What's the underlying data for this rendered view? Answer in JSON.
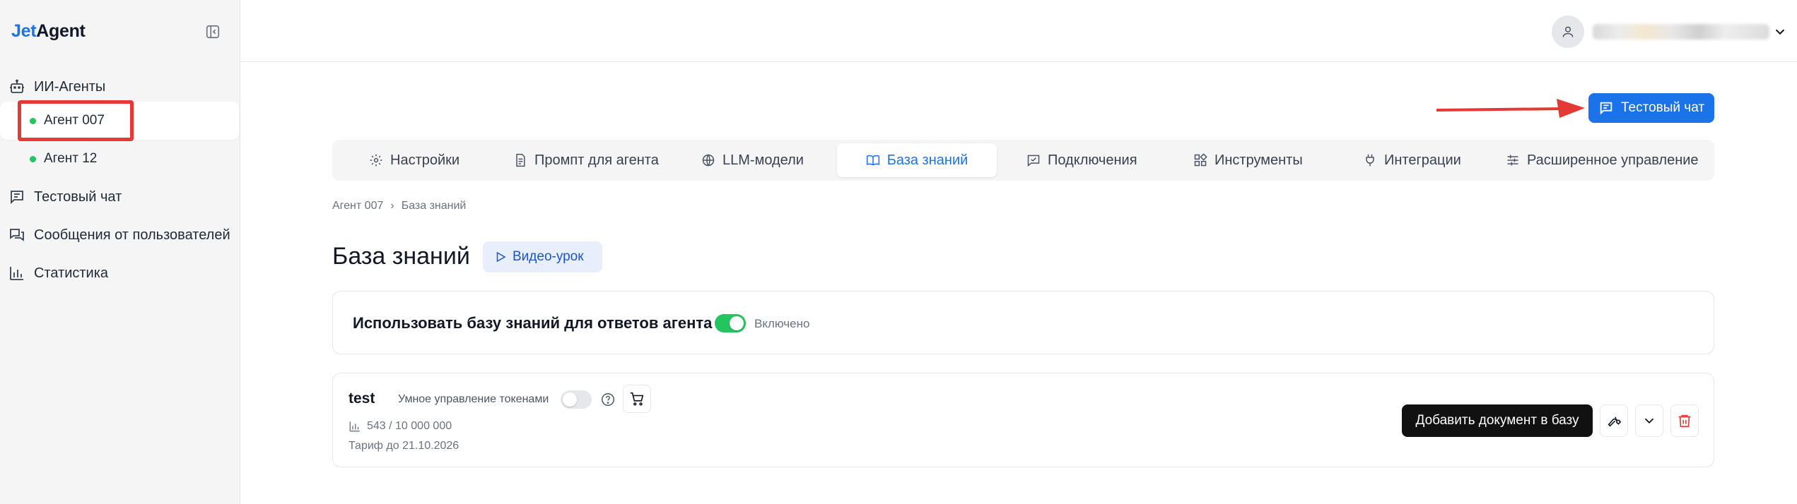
{
  "sidebar": {
    "logo": {
      "part1": "Jet",
      "part2": "Agent"
    },
    "items": [
      {
        "label": "ИИ-Агенты",
        "icon": "robot-icon"
      },
      {
        "label": "Агент 007",
        "active": true
      },
      {
        "label": "Агент 12"
      },
      {
        "label": "Тестовый чат",
        "icon": "chat-icon"
      },
      {
        "label": "Сообщения от пользователей",
        "icon": "messages-icon"
      },
      {
        "label": "Статистика",
        "icon": "chart-icon"
      }
    ]
  },
  "header": {
    "test_chat_button": "Тестовый чат"
  },
  "tabs": [
    {
      "label": "Настройки",
      "icon": "gear-icon"
    },
    {
      "label": "Промпт для агента",
      "icon": "document-icon"
    },
    {
      "label": "LLM-модели",
      "icon": "globe-icon"
    },
    {
      "label": "База знаний",
      "icon": "book-icon",
      "active": true
    },
    {
      "label": "Подключения",
      "icon": "connection-icon"
    },
    {
      "label": "Инструменты",
      "icon": "tools-icon"
    },
    {
      "label": "Интеграции",
      "icon": "plug-icon"
    },
    {
      "label": "Расширенное управление",
      "icon": "sliders-icon"
    }
  ],
  "breadcrumb": {
    "parent": "Агент 007",
    "separator": "›",
    "current": "База знаний"
  },
  "page": {
    "title": "База знаний",
    "video_button": "Видео-урок"
  },
  "kb_toggle": {
    "label": "Использовать базу знаний для ответов агента",
    "status": "Включено",
    "enabled": true
  },
  "document": {
    "name": "test",
    "smart_tokens_label": "Умное управление токенами",
    "smart_tokens_enabled": false,
    "tokens": "543 / 10 000 000",
    "tariff": "Тариф до 21.10.2026",
    "add_button": "Добавить документ в базу"
  },
  "colors": {
    "accent": "#1a73e8",
    "success": "#22c55e",
    "danger": "#e53935"
  }
}
